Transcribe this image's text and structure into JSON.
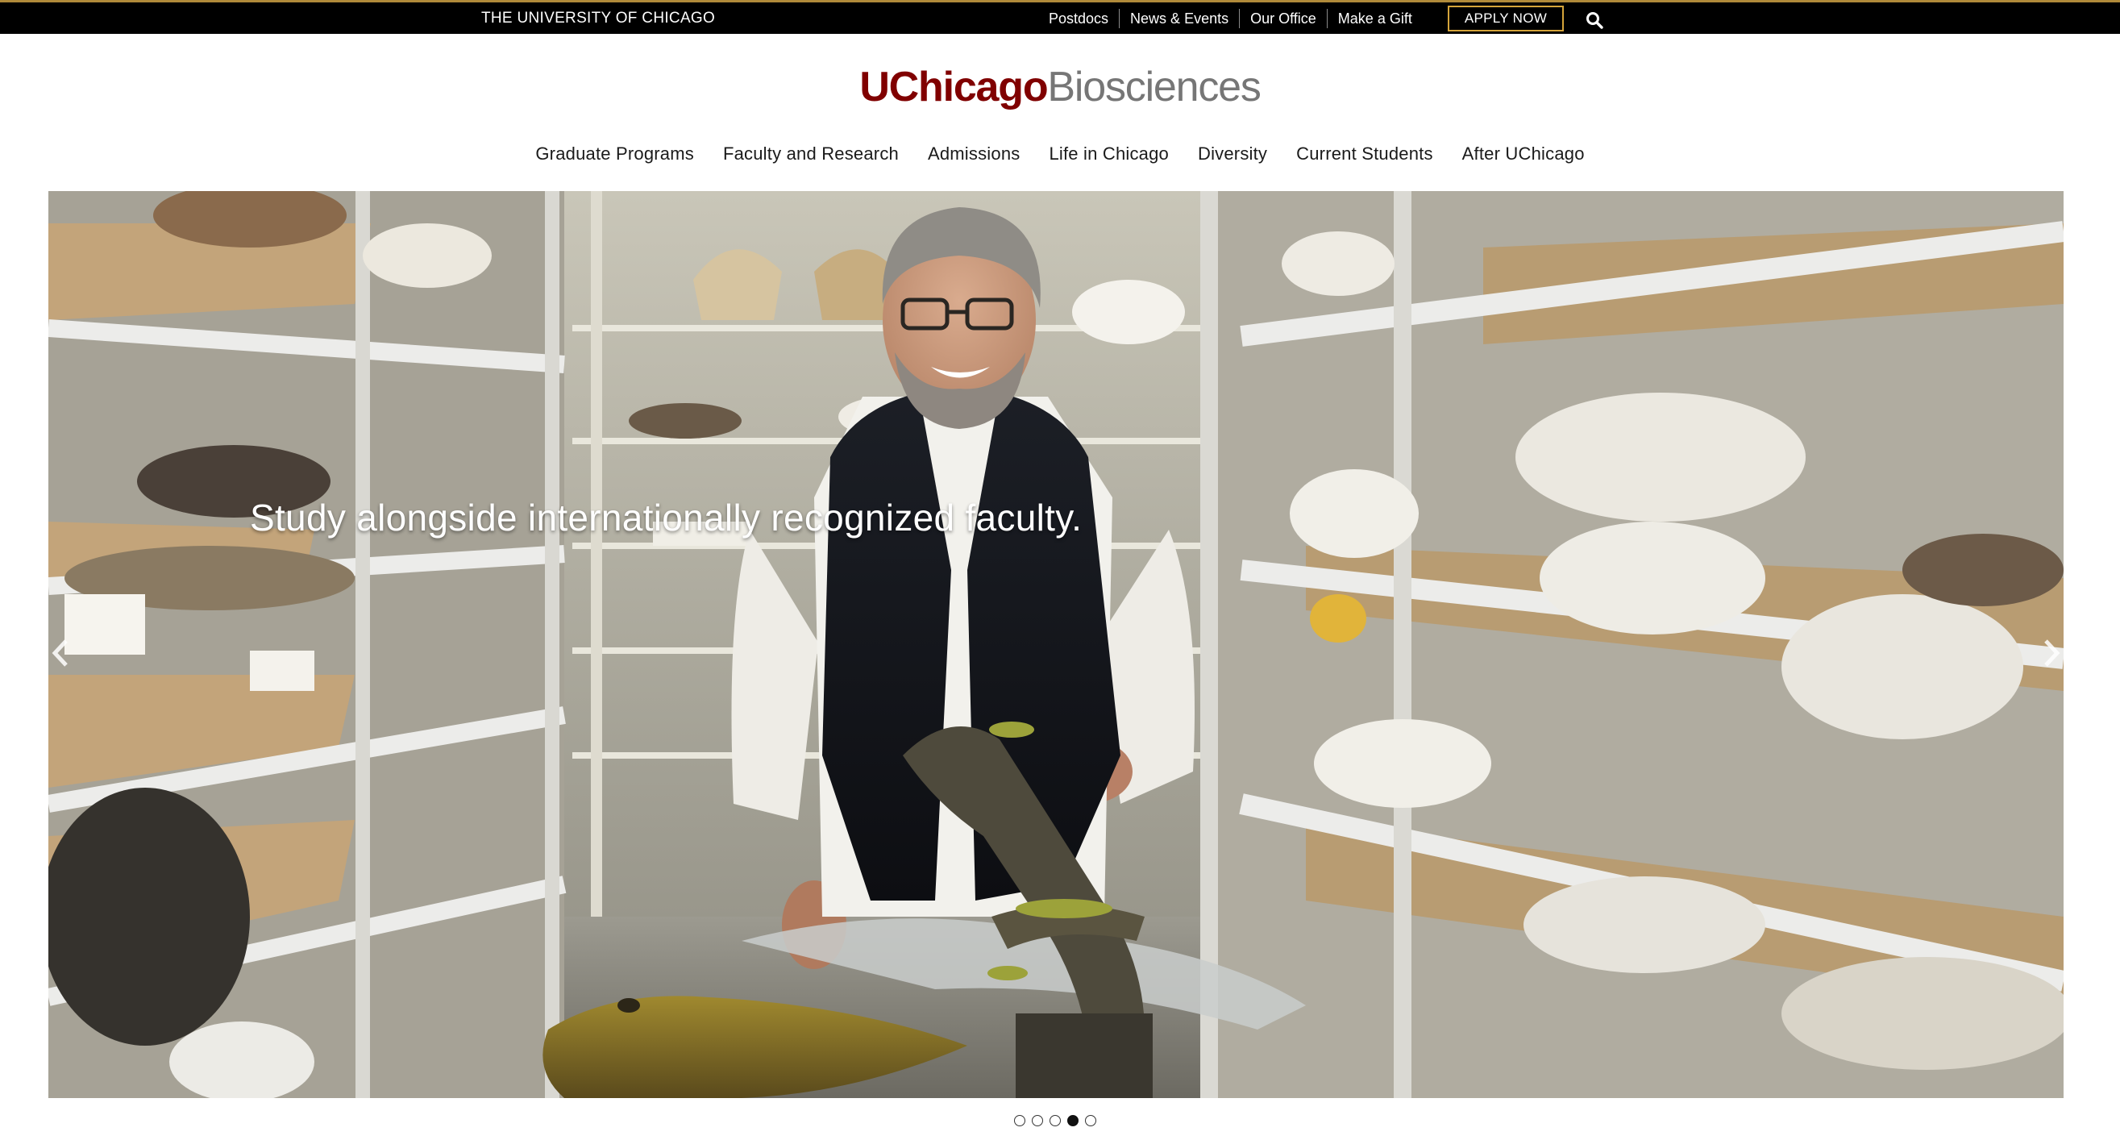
{
  "utility_bar": {
    "university": "THE UNIVERSITY OF CHICAGO",
    "links": [
      "Postdocs",
      "News & Events",
      "Our Office",
      "Make a Gift"
    ],
    "apply_label": "APPLY NOW",
    "search_icon": "search-icon"
  },
  "logo": {
    "part1": "UChicago",
    "part2": "Biosciences"
  },
  "nav": {
    "items": [
      "Graduate Programs",
      "Faculty and Research",
      "Admissions",
      "Life in Chicago",
      "Diversity",
      "Current Students",
      "After UChicago"
    ]
  },
  "hero": {
    "caption": "Study alongside internationally recognized faculty.",
    "prev_icon": "chevron-left-icon",
    "next_icon": "chevron-right-icon"
  },
  "carousel": {
    "slide_count": 5,
    "active_slide": 4
  },
  "colors": {
    "maroon": "#800000",
    "gray_logo": "#767676",
    "gold_accent": "#d5a43a",
    "bar_black": "#000000"
  }
}
